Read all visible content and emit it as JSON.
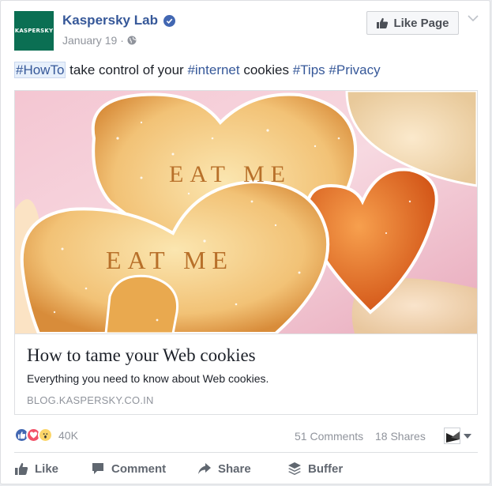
{
  "header": {
    "avatar_text": "KASPERSKY",
    "page_name": "Kaspersky Lab",
    "date": "January 19",
    "separator": "·",
    "like_page_label": "Like Page"
  },
  "post": {
    "hashtag_howto": "#HowTo",
    "text_1": " take control of your ",
    "hashtag_internet": "#internet",
    "text_2": " cookies ",
    "hashtag_tips": "#Tips",
    "text_3": " ",
    "hashtag_privacy": "#Privacy"
  },
  "link_preview": {
    "image_text_1": "EAT ME",
    "image_text_2": "EAT ME",
    "title": "How to tame your Web cookies",
    "description": "Everything you need to know about Web cookies.",
    "domain": "BLOG.KASPERSKY.CO.IN"
  },
  "stats": {
    "reaction_count": "40K",
    "comments": "51 Comments",
    "shares": "18 Shares"
  },
  "actions": {
    "like": "Like",
    "comment": "Comment",
    "share": "Share",
    "buffer": "Buffer"
  },
  "colors": {
    "link_blue": "#365899",
    "facebook_blue": "#4267b2",
    "avatar_green": "#0b6f53",
    "love_red": "#f25268",
    "wow_yellow": "#fcd669"
  }
}
